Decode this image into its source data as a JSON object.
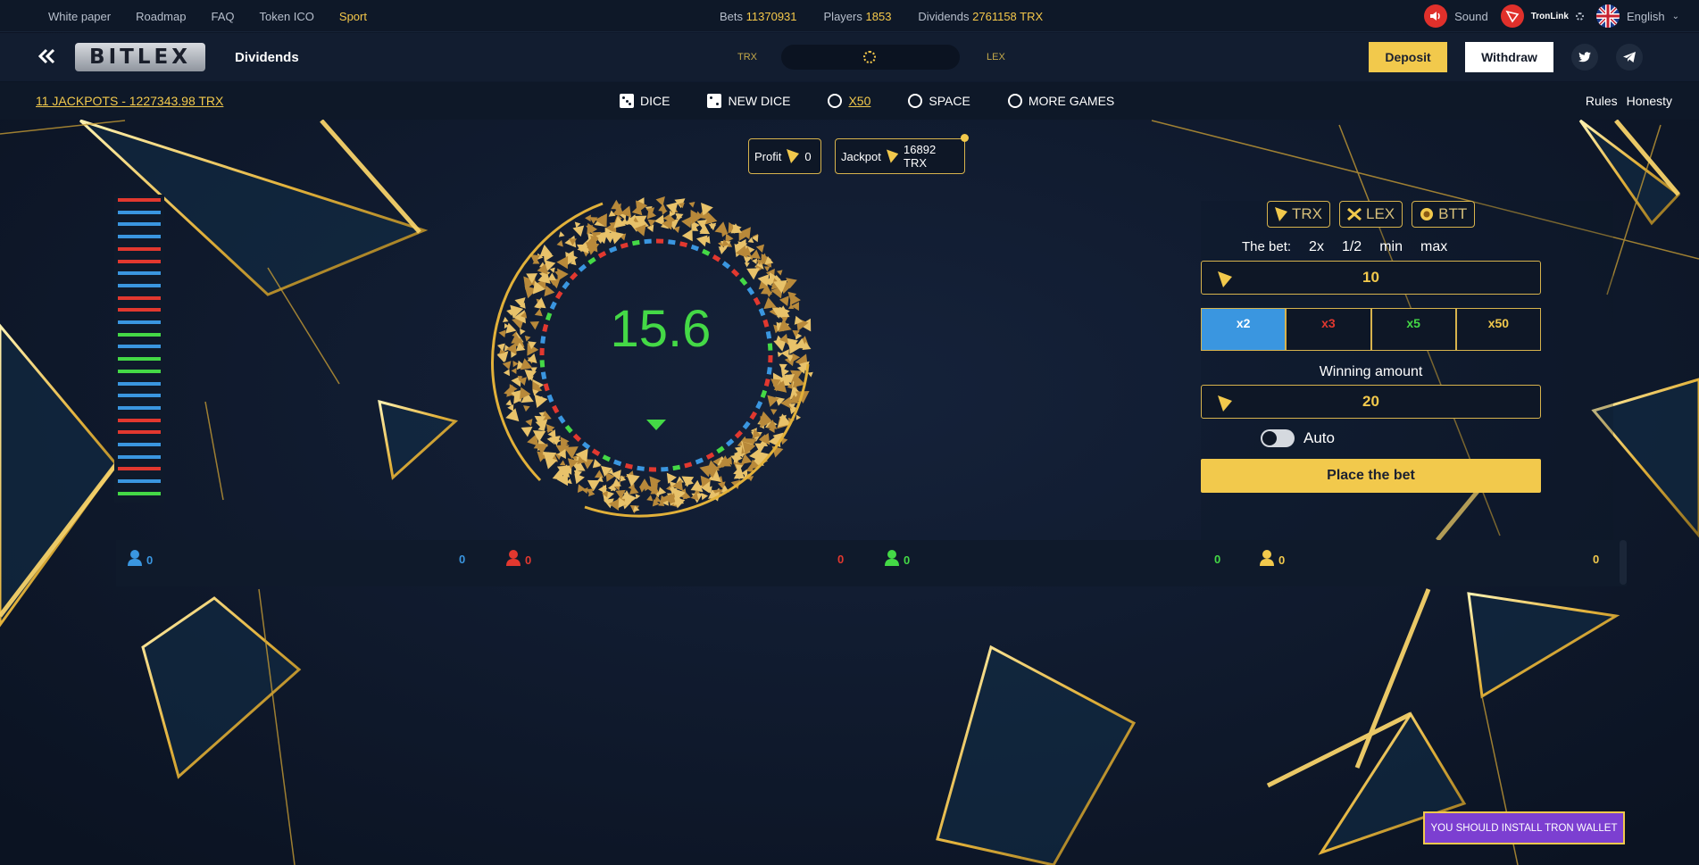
{
  "topbar": {
    "links": [
      "White paper",
      "Roadmap",
      "FAQ",
      "Token ICO",
      "Sport"
    ],
    "stats": {
      "bets_label": "Bets",
      "bets_value": "11370931",
      "players_label": "Players",
      "players_value": "1853",
      "dividends_label": "Dividends",
      "dividends_value": "2761158 TRX"
    },
    "sound_label": "Sound",
    "wallet_label": "TronLink",
    "language_label": "English"
  },
  "header": {
    "logo_text": "BITLEX",
    "dividends_link": "Dividends",
    "currency_left": "TRX",
    "currency_right": "LEX",
    "deposit_label": "Deposit",
    "withdraw_label": "Withdraw"
  },
  "nav": {
    "jackpots_link": "11 JACKPOTS - 1227343.98 TRX",
    "games": [
      {
        "label": "DICE",
        "icon": "dice-icon"
      },
      {
        "label": "NEW DICE",
        "icon": "new-dice-icon"
      },
      {
        "label": "X50",
        "icon": "x50-ring-icon"
      },
      {
        "label": "SPACE",
        "icon": "space-icon"
      },
      {
        "label": "MORE GAMES",
        "icon": "more-games-icon"
      }
    ],
    "rules_label": "Rules",
    "honesty_label": "Honesty"
  },
  "history": [
    "red",
    "blue",
    "blue",
    "blue",
    "red",
    "red",
    "blue",
    "blue",
    "red",
    "red",
    "blue",
    "green",
    "blue",
    "green",
    "green",
    "blue",
    "blue",
    "blue",
    "red",
    "red",
    "blue",
    "blue",
    "red",
    "blue",
    "green"
  ],
  "game": {
    "profit_label": "Profit",
    "profit_value": "0",
    "jackpot_label": "Jackpot",
    "jackpot_value": "16892 TRX",
    "wheel_value": "15.6"
  },
  "betpanel": {
    "currencies": [
      "TRX",
      "LEX",
      "BTT"
    ],
    "bet_label": "The bet:",
    "bet_modifiers": [
      "2x",
      "1/2",
      "min",
      "max"
    ],
    "bet_amount": "10",
    "multipliers": [
      {
        "label": "x2",
        "color": "#ffffff",
        "selected": true
      },
      {
        "label": "x3",
        "color": "#e2382f",
        "selected": false
      },
      {
        "label": "x5",
        "color": "#44d946",
        "selected": false
      },
      {
        "label": "x50",
        "color": "#f2c94c",
        "selected": false
      }
    ],
    "winning_label": "Winning amount",
    "winning_amount": "20",
    "auto_label": "Auto",
    "place_bet_label": "Place the bet"
  },
  "players": [
    {
      "color": "#3a96e0",
      "count": "0",
      "total": "0"
    },
    {
      "color": "#e2382f",
      "count": "0",
      "total": "0"
    },
    {
      "color": "#44d946",
      "count": "0",
      "total": "0"
    },
    {
      "color": "#f2c94c",
      "count": "0",
      "total": "0"
    }
  ],
  "tron_warning": "YOU SHOULD INSTALL TRON WALLET",
  "colors": {
    "accent": "#f2c94c",
    "red": "#e2382f",
    "blue": "#3a96e0",
    "green": "#44d946"
  }
}
